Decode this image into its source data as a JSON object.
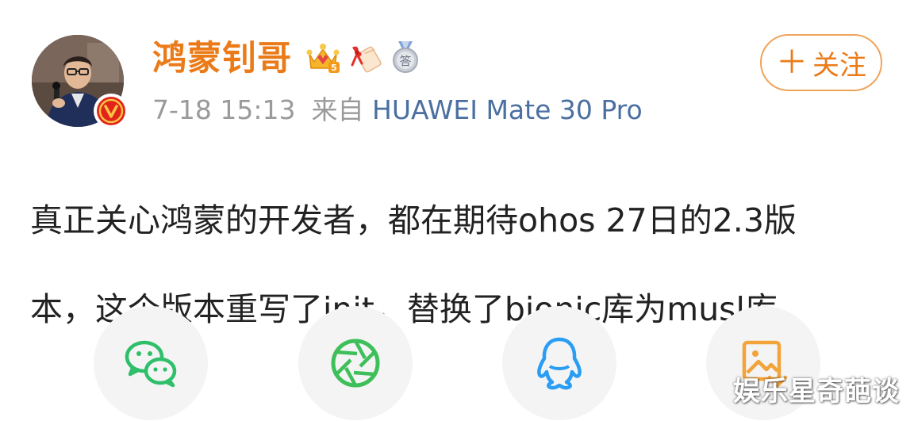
{
  "post": {
    "author": {
      "name": "鸿蒙钊哥",
      "avatar_icon": "person-avatar",
      "verified_badge_icon": "verified-v-badge",
      "verified_badge_color": "#e2231a",
      "badges": [
        {
          "icon": "vip-crown-badge-icon",
          "level": "5"
        },
        {
          "icon": "ribbon-scroll-badge-icon"
        },
        {
          "icon": "medal-answer-badge-icon",
          "char": "答"
        }
      ]
    },
    "timestamp": "7-18 15:13",
    "source_prefix": "来自",
    "device": "HUAWEI Mate 30 Pro",
    "follow": {
      "plus": "＋",
      "label": "关注"
    },
    "text_line1": "真正关心鸿蒙的开发者，都在期待ohos 27日的2.3版",
    "text_line2": "本，这个版本重写了init，替换了bionic库为musl库。"
  },
  "share_bar": [
    {
      "icon": "wechat-icon",
      "color": "#2fbf6a"
    },
    {
      "icon": "wechat-moments-icon",
      "color": "#3fbf5a"
    },
    {
      "icon": "qq-icon",
      "color": "#2a9df4"
    },
    {
      "icon": "save-image-icon",
      "color": "#f2a43a"
    }
  ],
  "watermark": "娱乐星奇葩谈",
  "colors": {
    "name_orange": "#eb7b19",
    "meta_gray": "#9a9a9a",
    "device_blue": "#4a6fa0",
    "body_text": "#222222",
    "share_bg": "#f4f4f4"
  }
}
